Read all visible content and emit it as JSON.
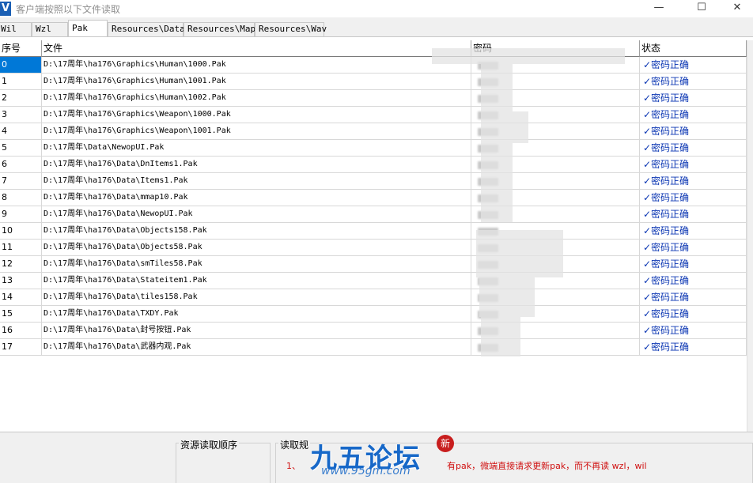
{
  "window": {
    "icon_letter": "V",
    "title": "客户端按照以下文件读取",
    "minimize_glyph": "—",
    "maximize_glyph": "☐",
    "close_glyph": "✕"
  },
  "tabs": [
    {
      "label": "Wil"
    },
    {
      "label": "Wzl"
    },
    {
      "label": "Pak",
      "active": true
    },
    {
      "label": "Resources\\Data"
    },
    {
      "label": "Resources\\Map"
    },
    {
      "label": "Resources\\Wav"
    }
  ],
  "grid": {
    "columns": {
      "index": "序号",
      "file": "文件",
      "password": "密码",
      "status": "状态"
    },
    "status_icon": "check-icon",
    "rows": [
      {
        "index": "0",
        "file": "D:\\17周年\\ha176\\Graphics\\Human\\1000.Pak",
        "status": "✓密码正确"
      },
      {
        "index": "1",
        "file": "D:\\17周年\\ha176\\Graphics\\Human\\1001.Pak",
        "status": "✓密码正确"
      },
      {
        "index": "2",
        "file": "D:\\17周年\\ha176\\Graphics\\Human\\1002.Pak",
        "status": "✓密码正确"
      },
      {
        "index": "3",
        "file": "D:\\17周年\\ha176\\Graphics\\Weapon\\1000.Pak",
        "status": "✓密码正确"
      },
      {
        "index": "4",
        "file": "D:\\17周年\\ha176\\Graphics\\Weapon\\1001.Pak",
        "status": "✓密码正确"
      },
      {
        "index": "5",
        "file": "D:\\17周年\\Data\\NewopUI.Pak",
        "status": "✓密码正确"
      },
      {
        "index": "6",
        "file": "D:\\17周年\\ha176\\Data\\DnItems1.Pak",
        "status": "✓密码正确"
      },
      {
        "index": "7",
        "file": "D:\\17周年\\ha176\\Data\\Items1.Pak",
        "status": "✓密码正确"
      },
      {
        "index": "8",
        "file": "D:\\17周年\\ha176\\Data\\mmap10.Pak",
        "status": "✓密码正确"
      },
      {
        "index": "9",
        "file": "D:\\17周年\\ha176\\Data\\NewopUI.Pak",
        "status": "✓密码正确"
      },
      {
        "index": "10",
        "file": "D:\\17周年\\ha176\\Data\\Objects158.Pak",
        "status": "✓密码正确"
      },
      {
        "index": "11",
        "file": "D:\\17周年\\ha176\\Data\\Objects58.Pak",
        "status": "✓密码正确"
      },
      {
        "index": "12",
        "file": "D:\\17周年\\ha176\\Data\\smTiles58.Pak",
        "status": "✓密码正确"
      },
      {
        "index": "13",
        "file": "D:\\17周年\\ha176\\Data\\Stateitem1.Pak",
        "status": "✓密码正确"
      },
      {
        "index": "14",
        "file": "D:\\17周年\\ha176\\Data\\tiles158.Pak",
        "status": "✓密码正确"
      },
      {
        "index": "15",
        "file": "D:\\17周年\\ha176\\Data\\TXDY.Pak",
        "status": "✓密码正确"
      },
      {
        "index": "16",
        "file": "D:\\17周年\\ha176\\Data\\封号按钮.Pak",
        "status": "✓密码正确"
      },
      {
        "index": "17",
        "file": "D:\\17周年\\ha176\\Data\\武器内观.Pak",
        "status": "✓密码正确"
      }
    ]
  },
  "bottom": {
    "order_label": "资源读取顺序",
    "rules_label": "读取规",
    "rules_text": "1、",
    "rules_text_tail": "有pak，微端直接请求更新pak，而不再读 wzl，wil"
  },
  "watermark": {
    "chinese": "九五论坛",
    "url": "www.95gm.com",
    "seal": "新"
  },
  "colors": {
    "selection": "#0078d7",
    "status_text": "#0b36b3",
    "rules_text": "#d01010",
    "watermark": "#1768c8"
  }
}
